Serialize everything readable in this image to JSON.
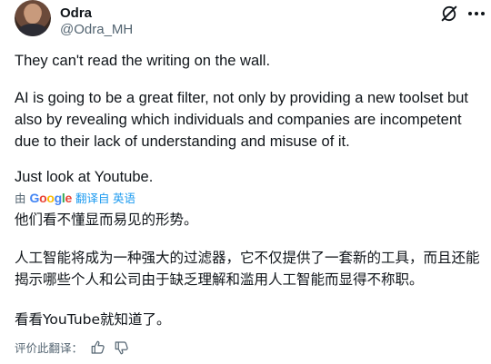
{
  "author": {
    "name": "Odra",
    "handle": "@Odra_MH"
  },
  "tweet": {
    "paragraphs": [
      "They can't read the writing on the wall.",
      "AI is going to be a great filter, not only by providing a new toolset but also by revealing which individuals and companies are incompetent due to their lack of understanding and misuse of it.",
      "Just look at Youtube."
    ]
  },
  "translation": {
    "by_prefix": "由",
    "google_letters": [
      "G",
      "o",
      "o",
      "g",
      "l",
      "e"
    ],
    "link_label": "翻译自 英语",
    "paragraphs": [
      "他们看不懂显而易见的形势。",
      "人工智能将成为一种强大的过滤器，它不仅提供了一套新的工具，而且还能揭示哪些个人和公司由于缺乏理解和滥用人工智能而显得不称职。",
      "看看YouTube就知道了。"
    ],
    "rate_label": "评价此翻译："
  },
  "icons": {
    "grok": "grok-icon",
    "more": "more-icon",
    "thumb_up": "thumb-up-icon",
    "thumb_down": "thumb-down-icon"
  },
  "colors": {
    "text": "#0f1419",
    "secondary": "#536471",
    "link": "#1d9bf0"
  }
}
